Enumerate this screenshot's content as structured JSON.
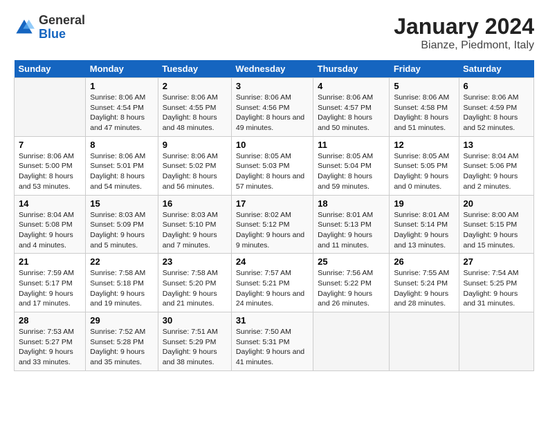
{
  "header": {
    "logo": {
      "general": "General",
      "blue": "Blue"
    },
    "title": "January 2024",
    "subtitle": "Bianze, Piedmont, Italy"
  },
  "columns": [
    "Sunday",
    "Monday",
    "Tuesday",
    "Wednesday",
    "Thursday",
    "Friday",
    "Saturday"
  ],
  "weeks": [
    [
      {
        "day": "",
        "sunrise": "",
        "sunset": "",
        "daylight": ""
      },
      {
        "day": "1",
        "sunrise": "Sunrise: 8:06 AM",
        "sunset": "Sunset: 4:54 PM",
        "daylight": "Daylight: 8 hours and 47 minutes."
      },
      {
        "day": "2",
        "sunrise": "Sunrise: 8:06 AM",
        "sunset": "Sunset: 4:55 PM",
        "daylight": "Daylight: 8 hours and 48 minutes."
      },
      {
        "day": "3",
        "sunrise": "Sunrise: 8:06 AM",
        "sunset": "Sunset: 4:56 PM",
        "daylight": "Daylight: 8 hours and 49 minutes."
      },
      {
        "day": "4",
        "sunrise": "Sunrise: 8:06 AM",
        "sunset": "Sunset: 4:57 PM",
        "daylight": "Daylight: 8 hours and 50 minutes."
      },
      {
        "day": "5",
        "sunrise": "Sunrise: 8:06 AM",
        "sunset": "Sunset: 4:58 PM",
        "daylight": "Daylight: 8 hours and 51 minutes."
      },
      {
        "day": "6",
        "sunrise": "Sunrise: 8:06 AM",
        "sunset": "Sunset: 4:59 PM",
        "daylight": "Daylight: 8 hours and 52 minutes."
      }
    ],
    [
      {
        "day": "7",
        "sunrise": "Sunrise: 8:06 AM",
        "sunset": "Sunset: 5:00 PM",
        "daylight": "Daylight: 8 hours and 53 minutes."
      },
      {
        "day": "8",
        "sunrise": "Sunrise: 8:06 AM",
        "sunset": "Sunset: 5:01 PM",
        "daylight": "Daylight: 8 hours and 54 minutes."
      },
      {
        "day": "9",
        "sunrise": "Sunrise: 8:06 AM",
        "sunset": "Sunset: 5:02 PM",
        "daylight": "Daylight: 8 hours and 56 minutes."
      },
      {
        "day": "10",
        "sunrise": "Sunrise: 8:05 AM",
        "sunset": "Sunset: 5:03 PM",
        "daylight": "Daylight: 8 hours and 57 minutes."
      },
      {
        "day": "11",
        "sunrise": "Sunrise: 8:05 AM",
        "sunset": "Sunset: 5:04 PM",
        "daylight": "Daylight: 8 hours and 59 minutes."
      },
      {
        "day": "12",
        "sunrise": "Sunrise: 8:05 AM",
        "sunset": "Sunset: 5:05 PM",
        "daylight": "Daylight: 9 hours and 0 minutes."
      },
      {
        "day": "13",
        "sunrise": "Sunrise: 8:04 AM",
        "sunset": "Sunset: 5:06 PM",
        "daylight": "Daylight: 9 hours and 2 minutes."
      }
    ],
    [
      {
        "day": "14",
        "sunrise": "Sunrise: 8:04 AM",
        "sunset": "Sunset: 5:08 PM",
        "daylight": "Daylight: 9 hours and 4 minutes."
      },
      {
        "day": "15",
        "sunrise": "Sunrise: 8:03 AM",
        "sunset": "Sunset: 5:09 PM",
        "daylight": "Daylight: 9 hours and 5 minutes."
      },
      {
        "day": "16",
        "sunrise": "Sunrise: 8:03 AM",
        "sunset": "Sunset: 5:10 PM",
        "daylight": "Daylight: 9 hours and 7 minutes."
      },
      {
        "day": "17",
        "sunrise": "Sunrise: 8:02 AM",
        "sunset": "Sunset: 5:12 PM",
        "daylight": "Daylight: 9 hours and 9 minutes."
      },
      {
        "day": "18",
        "sunrise": "Sunrise: 8:01 AM",
        "sunset": "Sunset: 5:13 PM",
        "daylight": "Daylight: 9 hours and 11 minutes."
      },
      {
        "day": "19",
        "sunrise": "Sunrise: 8:01 AM",
        "sunset": "Sunset: 5:14 PM",
        "daylight": "Daylight: 9 hours and 13 minutes."
      },
      {
        "day": "20",
        "sunrise": "Sunrise: 8:00 AM",
        "sunset": "Sunset: 5:15 PM",
        "daylight": "Daylight: 9 hours and 15 minutes."
      }
    ],
    [
      {
        "day": "21",
        "sunrise": "Sunrise: 7:59 AM",
        "sunset": "Sunset: 5:17 PM",
        "daylight": "Daylight: 9 hours and 17 minutes."
      },
      {
        "day": "22",
        "sunrise": "Sunrise: 7:58 AM",
        "sunset": "Sunset: 5:18 PM",
        "daylight": "Daylight: 9 hours and 19 minutes."
      },
      {
        "day": "23",
        "sunrise": "Sunrise: 7:58 AM",
        "sunset": "Sunset: 5:20 PM",
        "daylight": "Daylight: 9 hours and 21 minutes."
      },
      {
        "day": "24",
        "sunrise": "Sunrise: 7:57 AM",
        "sunset": "Sunset: 5:21 PM",
        "daylight": "Daylight: 9 hours and 24 minutes."
      },
      {
        "day": "25",
        "sunrise": "Sunrise: 7:56 AM",
        "sunset": "Sunset: 5:22 PM",
        "daylight": "Daylight: 9 hours and 26 minutes."
      },
      {
        "day": "26",
        "sunrise": "Sunrise: 7:55 AM",
        "sunset": "Sunset: 5:24 PM",
        "daylight": "Daylight: 9 hours and 28 minutes."
      },
      {
        "day": "27",
        "sunrise": "Sunrise: 7:54 AM",
        "sunset": "Sunset: 5:25 PM",
        "daylight": "Daylight: 9 hours and 31 minutes."
      }
    ],
    [
      {
        "day": "28",
        "sunrise": "Sunrise: 7:53 AM",
        "sunset": "Sunset: 5:27 PM",
        "daylight": "Daylight: 9 hours and 33 minutes."
      },
      {
        "day": "29",
        "sunrise": "Sunrise: 7:52 AM",
        "sunset": "Sunset: 5:28 PM",
        "daylight": "Daylight: 9 hours and 35 minutes."
      },
      {
        "day": "30",
        "sunrise": "Sunrise: 7:51 AM",
        "sunset": "Sunset: 5:29 PM",
        "daylight": "Daylight: 9 hours and 38 minutes."
      },
      {
        "day": "31",
        "sunrise": "Sunrise: 7:50 AM",
        "sunset": "Sunset: 5:31 PM",
        "daylight": "Daylight: 9 hours and 41 minutes."
      },
      {
        "day": "",
        "sunrise": "",
        "sunset": "",
        "daylight": ""
      },
      {
        "day": "",
        "sunrise": "",
        "sunset": "",
        "daylight": ""
      },
      {
        "day": "",
        "sunrise": "",
        "sunset": "",
        "daylight": ""
      }
    ]
  ]
}
